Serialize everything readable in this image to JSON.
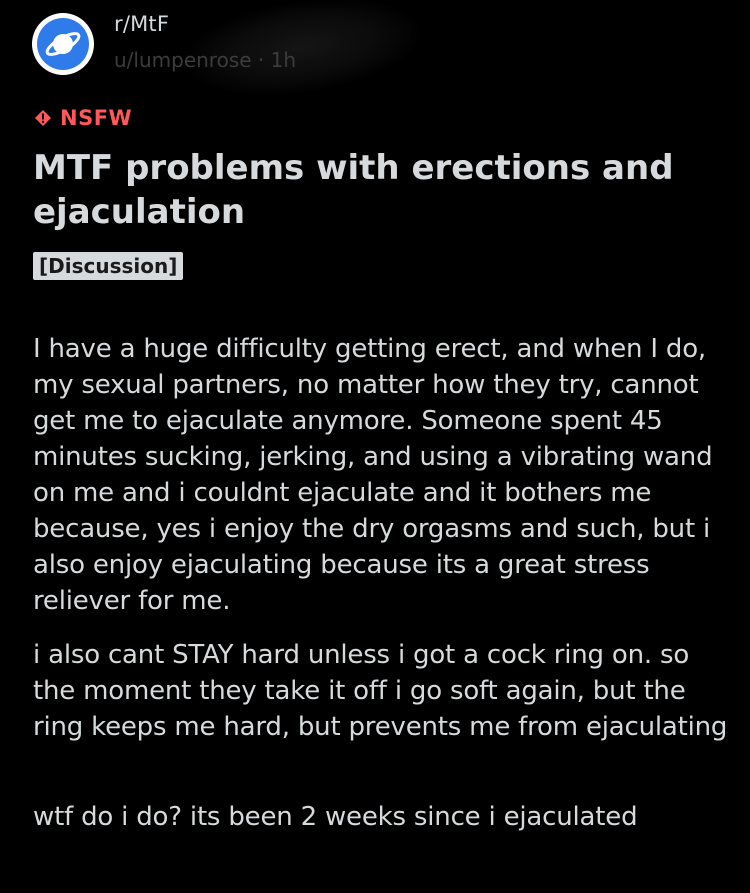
{
  "post": {
    "subreddit": "r/MtF",
    "author_line": "u/lumpenrose · 1h",
    "nsfw_label": "NSFW",
    "title": "MTF problems with erections and ejaculation",
    "flair": "[Discussion]",
    "paragraphs": [
      "I have a huge difficulty getting erect, and when I do, my sexual partners, no matter how they try, cannot get me to ejaculate anymore. Someone spent 45 minutes sucking, jerking, and using a vibrating wand on me and i couldnt ejaculate and it bothers me because, yes i enjoy the dry orgasms and such, but i also enjoy ejaculating because its a great stress reliever for me.",
      "i also cant STAY hard unless i got a cock ring on. so the moment they take it off i go soft again, but the ring keeps me hard, but prevents me from ejaculating",
      "wtf do i do? its been 2 weeks since i ejaculated"
    ]
  },
  "icons": {
    "avatar": "planet-icon",
    "nsfw": "nsfw-diamond-icon"
  },
  "colors": {
    "background": "#000000",
    "text": "#d7dadc",
    "nsfw": "#ff585b",
    "avatar_blue": "#2f7bea"
  }
}
